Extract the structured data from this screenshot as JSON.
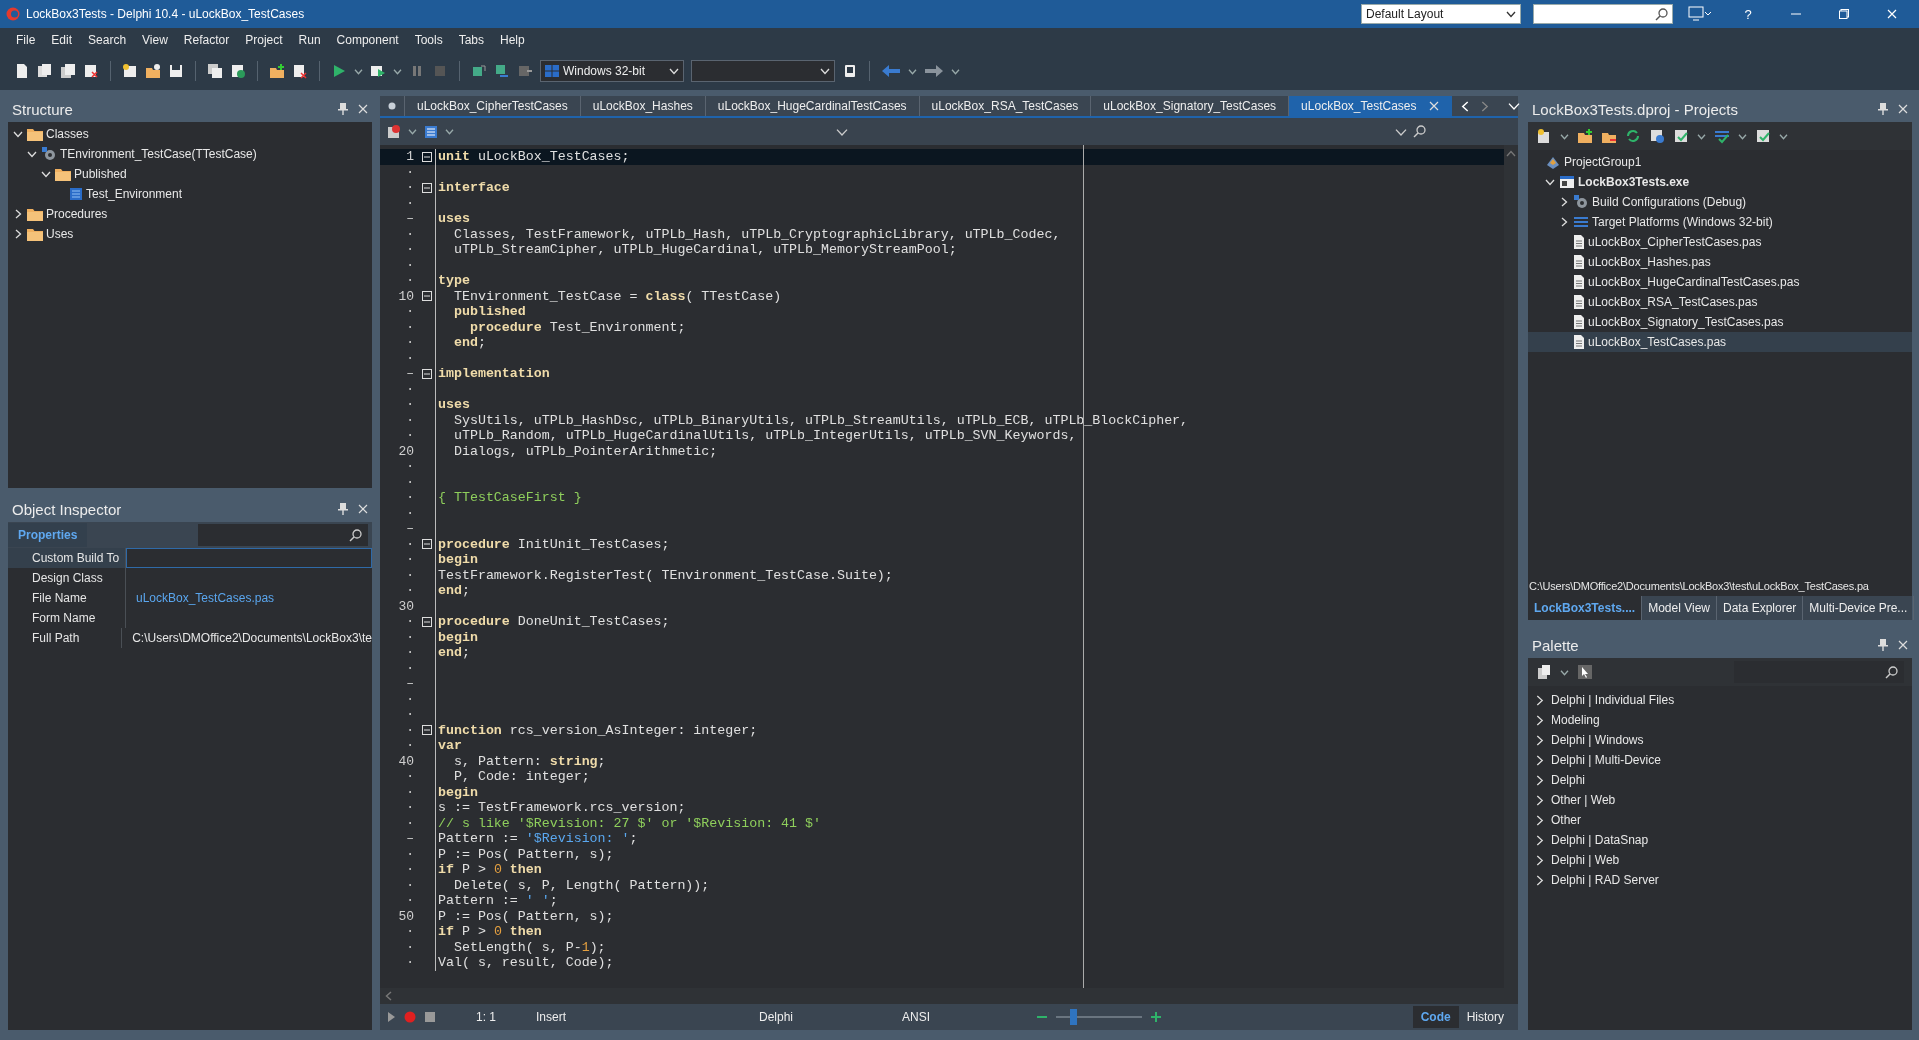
{
  "window": {
    "title": "LockBox3Tests - Delphi 10.4 - uLockBox_TestCases",
    "layout": "Default Layout",
    "help": "?"
  },
  "menu": [
    "File",
    "Edit",
    "Search",
    "View",
    "Refactor",
    "Project",
    "Run",
    "Component",
    "Tools",
    "Tabs",
    "Help"
  ],
  "toolbar": {
    "platform": "Windows 32-bit"
  },
  "structure": {
    "title": "Structure",
    "tree": [
      {
        "label": "Classes",
        "kind": "folder",
        "expanded": true,
        "children": [
          {
            "label": "TEnvironment_TestCase(TTestCase)",
            "kind": "class",
            "expanded": true,
            "children": [
              {
                "label": "Published",
                "kind": "folder",
                "expanded": true,
                "children": [
                  {
                    "label": "Test_Environment",
                    "kind": "method"
                  }
                ]
              }
            ]
          }
        ]
      },
      {
        "label": "Procedures",
        "kind": "folder",
        "expanded": false
      },
      {
        "label": "Uses",
        "kind": "folder",
        "expanded": false
      }
    ]
  },
  "object_inspector": {
    "title": "Object Inspector",
    "tabs": [
      {
        "label": "Properties",
        "selected": true
      }
    ],
    "properties": [
      {
        "name": "Custom Build To",
        "selected": true
      },
      {
        "name": "Design Class",
        "selected": false
      },
      {
        "name": "File Name",
        "value": "uLockBox_TestCases.pas",
        "kind": "file",
        "selected": false
      },
      {
        "name": "Form Name",
        "selected": false
      },
      {
        "name": "Full Path",
        "value": "C:\\Users\\DMOffice2\\Documents\\LockBox3\\te",
        "kind": "text",
        "selected": false
      }
    ]
  },
  "editor": {
    "tabs": [
      {
        "label": "uLockBox_CipherTestCases",
        "selected": false
      },
      {
        "label": "uLockBox_Hashes",
        "selected": false
      },
      {
        "label": "uLockBox_HugeCardinalTestCases",
        "selected": false
      },
      {
        "label": "uLockBox_RSA_TestCases",
        "selected": false
      },
      {
        "label": "uLockBox_Signatory_TestCases",
        "selected": false
      },
      {
        "label": "uLockBox_TestCases",
        "selected": true
      }
    ],
    "lines": [
      {
        "gutter": "1",
        "fold": true,
        "current": true,
        "tokens": [
          {
            "kind": "kw",
            "text": "unit"
          },
          {
            "kind": "id",
            "text": " uLockBox_TestCases;"
          }
        ]
      },
      {
        "gutter": "·",
        "fold": false,
        "current": false
      },
      {
        "gutter": "·",
        "fold": true,
        "current": false,
        "tokens": [
          {
            "kind": "kw",
            "text": "interface"
          }
        ]
      },
      {
        "gutter": "·",
        "fold": false,
        "current": false
      },
      {
        "gutter": "–",
        "fold": false,
        "current": false,
        "tokens": [
          {
            "kind": "kw",
            "text": "uses"
          }
        ]
      },
      {
        "gutter": "·",
        "fold": false,
        "current": false,
        "tokens": [
          {
            "kind": "id",
            "text": "  Classes, TestFramework, uTPLb_Hash, uTPLb_CryptographicLibrary, uTPLb_Codec,"
          }
        ]
      },
      {
        "gutter": "·",
        "fold": false,
        "current": false,
        "tokens": [
          {
            "kind": "id",
            "text": "  uTPLb_StreamCipher, uTPLb_HugeCardinal, uTPLb_MemoryStreamPool;"
          }
        ]
      },
      {
        "gutter": "·",
        "fold": false,
        "current": false
      },
      {
        "gutter": "·",
        "fold": false,
        "current": false,
        "tokens": [
          {
            "kind": "kw",
            "text": "type"
          }
        ]
      },
      {
        "gutter": "10",
        "fold": true,
        "current": false,
        "tokens": [
          {
            "kind": "id",
            "text": "  TEnvironment_TestCase = "
          },
          {
            "kind": "kw",
            "text": "class"
          },
          {
            "kind": "id",
            "text": "( TTestCase)"
          }
        ]
      },
      {
        "gutter": "·",
        "fold": false,
        "current": false,
        "tokens": [
          {
            "kind": "kw",
            "text": "  published"
          }
        ]
      },
      {
        "gutter": "·",
        "fold": false,
        "current": false,
        "tokens": [
          {
            "kind": "kw",
            "text": "    procedure"
          },
          {
            "kind": "id",
            "text": " Test_Environment;"
          }
        ]
      },
      {
        "gutter": "·",
        "fold": false,
        "current": false,
        "tokens": [
          {
            "kind": "kw",
            "text": "  end"
          },
          {
            "kind": "id",
            "text": ";"
          }
        ]
      },
      {
        "gutter": "·",
        "fold": false,
        "current": false
      },
      {
        "gutter": "–",
        "fold": true,
        "current": false,
        "tokens": [
          {
            "kind": "kw",
            "text": "implementation"
          }
        ]
      },
      {
        "gutter": "·",
        "fold": false,
        "current": false
      },
      {
        "gutter": "·",
        "fold": false,
        "current": false,
        "tokens": [
          {
            "kind": "kw",
            "text": "uses"
          }
        ]
      },
      {
        "gutter": "·",
        "fold": false,
        "current": false,
        "tokens": [
          {
            "kind": "id",
            "text": "  SysUtils, uTPLb_HashDsc, uTPLb_BinaryUtils, uTPLb_StreamUtils, uTPLb_ECB, uTPLb_BlockCipher,"
          }
        ]
      },
      {
        "gutter": "·",
        "fold": false,
        "current": false,
        "tokens": [
          {
            "kind": "id",
            "text": "  uTPLb_Random, uTPLb_HugeCardinalUtils, uTPLb_IntegerUtils, uTPLb_SVN_Keywords,"
          }
        ]
      },
      {
        "gutter": "20",
        "fold": false,
        "current": false,
        "tokens": [
          {
            "kind": "id",
            "text": "  Dialogs, uTPLb_PointerArithmetic;"
          }
        ]
      },
      {
        "gutter": "·",
        "fold": false,
        "current": false
      },
      {
        "gutter": "·",
        "fold": false,
        "current": false
      },
      {
        "gutter": "·",
        "fold": false,
        "current": false,
        "tokens": [
          {
            "kind": "cmt",
            "text": "{ TTestCaseFirst }"
          }
        ]
      },
      {
        "gutter": "·",
        "fold": false,
        "current": false
      },
      {
        "gutter": "–",
        "fold": false,
        "current": false
      },
      {
        "gutter": "·",
        "fold": true,
        "current": false,
        "tokens": [
          {
            "kind": "kw",
            "text": "procedure"
          },
          {
            "kind": "id",
            "text": " InitUnit_TestCases;"
          }
        ]
      },
      {
        "gutter": "·",
        "fold": false,
        "current": false,
        "tokens": [
          {
            "kind": "kw",
            "text": "begin"
          }
        ]
      },
      {
        "gutter": "·",
        "fold": false,
        "current": false,
        "tokens": [
          {
            "kind": "id",
            "text": "TestFramework.RegisterTest( TEnvironment_TestCase.Suite);"
          }
        ]
      },
      {
        "gutter": "·",
        "fold": false,
        "current": false,
        "tokens": [
          {
            "kind": "kw",
            "text": "end"
          },
          {
            "kind": "id",
            "text": ";"
          }
        ]
      },
      {
        "gutter": "30",
        "fold": false,
        "current": false
      },
      {
        "gutter": "·",
        "fold": true,
        "current": false,
        "tokens": [
          {
            "kind": "kw",
            "text": "procedure"
          },
          {
            "kind": "id",
            "text": " DoneUnit_TestCases;"
          }
        ]
      },
      {
        "gutter": "·",
        "fold": false,
        "current": false,
        "tokens": [
          {
            "kind": "kw",
            "text": "begin"
          }
        ]
      },
      {
        "gutter": "·",
        "fold": false,
        "current": false,
        "tokens": [
          {
            "kind": "kw",
            "text": "end"
          },
          {
            "kind": "id",
            "text": ";"
          }
        ]
      },
      {
        "gutter": "·",
        "fold": false,
        "current": false
      },
      {
        "gutter": "–",
        "fold": false,
        "current": false
      },
      {
        "gutter": "·",
        "fold": false,
        "current": false
      },
      {
        "gutter": "·",
        "fold": false,
        "current": false
      },
      {
        "gutter": "·",
        "fold": true,
        "current": false,
        "tokens": [
          {
            "kind": "kw",
            "text": "function"
          },
          {
            "kind": "id",
            "text": " rcs_version_AsInteger: integer;"
          }
        ]
      },
      {
        "gutter": "·",
        "fold": false,
        "current": false,
        "tokens": [
          {
            "kind": "kw",
            "text": "var"
          }
        ]
      },
      {
        "gutter": "40",
        "fold": false,
        "current": false,
        "tokens": [
          {
            "kind": "id",
            "text": "  s, Pattern: "
          },
          {
            "kind": "kw",
            "text": "string"
          },
          {
            "kind": "id",
            "text": ";"
          }
        ]
      },
      {
        "gutter": "·",
        "fold": false,
        "current": false,
        "tokens": [
          {
            "kind": "id",
            "text": "  P, Code: integer;"
          }
        ]
      },
      {
        "gutter": "·",
        "fold": false,
        "current": false,
        "tokens": [
          {
            "kind": "kw",
            "text": "begin"
          }
        ]
      },
      {
        "gutter": "·",
        "fold": false,
        "current": false,
        "tokens": [
          {
            "kind": "id",
            "text": "s := TestFramework.rcs_version;"
          }
        ]
      },
      {
        "gutter": "·",
        "fold": false,
        "current": false,
        "tokens": [
          {
            "kind": "cmt",
            "text": "// s like '$Revision: 27 $' or '$Revision: 41 $'"
          }
        ]
      },
      {
        "gutter": "–",
        "fold": false,
        "current": false,
        "tokens": [
          {
            "kind": "id",
            "text": "Pattern := "
          },
          {
            "kind": "str",
            "text": "'$Revision: '"
          },
          {
            "kind": "id",
            "text": ";"
          }
        ]
      },
      {
        "gutter": "·",
        "fold": false,
        "current": false,
        "tokens": [
          {
            "kind": "id",
            "text": "P := Pos( Pattern, s);"
          }
        ]
      },
      {
        "gutter": "·",
        "fold": false,
        "current": false,
        "tokens": [
          {
            "kind": "kw",
            "text": "if"
          },
          {
            "kind": "id",
            "text": " P > "
          },
          {
            "kind": "num",
            "text": "0"
          },
          {
            "kind": "kw",
            "text": " then"
          }
        ]
      },
      {
        "gutter": "·",
        "fold": false,
        "current": false,
        "tokens": [
          {
            "kind": "id",
            "text": "  Delete( s, P, Length( Pattern));"
          }
        ]
      },
      {
        "gutter": "·",
        "fold": false,
        "current": false,
        "tokens": [
          {
            "kind": "id",
            "text": "Pattern := "
          },
          {
            "kind": "str",
            "text": "' '"
          },
          {
            "kind": "id",
            "text": ";"
          }
        ]
      },
      {
        "gutter": "50",
        "fold": false,
        "current": false,
        "tokens": [
          {
            "kind": "id",
            "text": "P := Pos( Pattern, s);"
          }
        ]
      },
      {
        "gutter": "·",
        "fold": false,
        "current": false,
        "tokens": [
          {
            "kind": "kw",
            "text": "if"
          },
          {
            "kind": "id",
            "text": " P > "
          },
          {
            "kind": "num",
            "text": "0"
          },
          {
            "kind": "kw",
            "text": " then"
          }
        ]
      },
      {
        "gutter": "·",
        "fold": false,
        "current": false,
        "tokens": [
          {
            "kind": "id",
            "text": "  SetLength( s, P-"
          },
          {
            "kind": "num",
            "text": "1"
          },
          {
            "kind": "id",
            "text": ");"
          }
        ]
      },
      {
        "gutter": "·",
        "fold": false,
        "current": false,
        "tokens": [
          {
            "kind": "id",
            "text": "Val( s, result, Code);"
          }
        ]
      }
    ],
    "status": {
      "position": "1: 1",
      "mode": "Insert",
      "language": "Delphi",
      "encoding": "ANSI",
      "zoom": {
        "level": 0.2
      },
      "views": [
        {
          "label": "Code",
          "selected": true
        },
        {
          "label": "History",
          "selected": false
        }
      ]
    }
  },
  "projects": {
    "title": "LockBox3Tests.dproj - Projects",
    "tree": [
      {
        "label": "ProjectGroup1",
        "kind": "group",
        "selected": false,
        "children": [
          {
            "label": "LockBox3Tests.exe",
            "kind": "project",
            "expanded": true,
            "selected": false,
            "children": [
              {
                "label": "Build Configurations (Debug)",
                "kind": "config",
                "expanded": false,
                "selected": false
              },
              {
                "label": "Target Platforms (Windows 32-bit)",
                "kind": "platforms",
                "expanded": false,
                "selected": false
              },
              {
                "label": "uLockBox_CipherTestCases.pas",
                "kind": "file",
                "selected": false
              },
              {
                "label": "uLockBox_Hashes.pas",
                "kind": "file",
                "selected": false
              },
              {
                "label": "uLockBox_HugeCardinalTestCases.pas",
                "kind": "file",
                "selected": false
              },
              {
                "label": "uLockBox_RSA_TestCases.pas",
                "kind": "file",
                "selected": false
              },
              {
                "label": "uLockBox_Signatory_TestCases.pas",
                "kind": "file",
                "selected": false
              },
              {
                "label": "uLockBox_TestCases.pas",
                "kind": "file",
                "selected": true
              }
            ]
          }
        ]
      }
    ],
    "path": "C:\\Users\\DMOffice2\\Documents\\LockBox3\\test\\uLockBox_TestCases.pa",
    "tabs": [
      {
        "label": "LockBox3Tests....",
        "selected": true
      },
      {
        "label": "Model View",
        "selected": false
      },
      {
        "label": "Data Explorer",
        "selected": false
      },
      {
        "label": "Multi-Device Pre...",
        "selected": false
      }
    ]
  },
  "palette": {
    "title": "Palette",
    "categories": [
      {
        "label": "Delphi | Individual Files",
        "expanded": false
      },
      {
        "label": "Modeling",
        "expanded": false
      },
      {
        "label": "Delphi | Windows",
        "expanded": false
      },
      {
        "label": "Delphi | Multi-Device",
        "expanded": false
      },
      {
        "label": "Delphi",
        "expanded": false
      },
      {
        "label": "Other | Web",
        "expanded": false
      },
      {
        "label": "Other",
        "expanded": false
      },
      {
        "label": "Delphi | DataSnap",
        "expanded": false
      },
      {
        "label": "Delphi | Web",
        "expanded": false
      },
      {
        "label": "Delphi | RAD Server",
        "expanded": false
      }
    ]
  }
}
